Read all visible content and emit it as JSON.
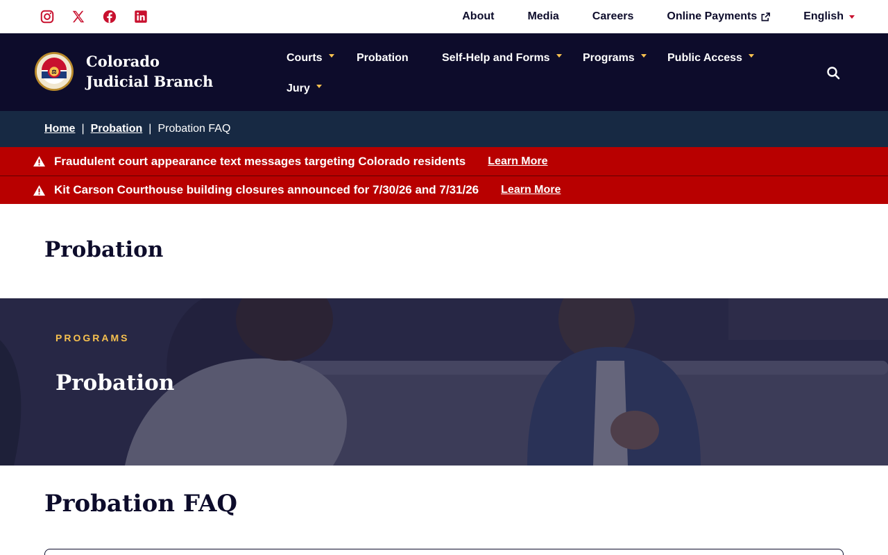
{
  "colors": {
    "navy": "#0d0c2b",
    "breadcrumb_bg": "#172943",
    "alert_red": "#b80000",
    "brand_red": "#c8102e",
    "gold": "#f7c14f"
  },
  "social": [
    {
      "icon": "instagram-icon"
    },
    {
      "icon": "x-twitter-icon"
    },
    {
      "icon": "facebook-icon"
    },
    {
      "icon": "linkedin-icon"
    }
  ],
  "utility_nav": {
    "about": "About",
    "media": "Media",
    "careers": "Careers",
    "online_payments": "Online Payments",
    "language": "English"
  },
  "brand": {
    "name": "Colorado Judicial Branch",
    "seal_top": "COLORADO",
    "seal_bottom": "COURTS"
  },
  "main_nav": {
    "courts": "Courts",
    "probation": "Probation",
    "self_help": "Self-Help and Forms",
    "programs": "Programs",
    "public_access": "Public Access",
    "jury": "Jury"
  },
  "breadcrumb": {
    "home": "Home",
    "probation": "Probation",
    "current": "Probation FAQ"
  },
  "alerts": [
    {
      "text": "Fraudulent court appearance text messages targeting Colorado residents",
      "link": "Learn More"
    },
    {
      "text": "Kit Carson Courthouse building closures announced for 7/30/26 and 7/31/26",
      "link": "Learn More"
    }
  ],
  "page_title": "Probation",
  "hero": {
    "eyebrow": "PROGRAMS",
    "title": "Probation"
  },
  "faq": {
    "title": "Probation FAQ"
  }
}
